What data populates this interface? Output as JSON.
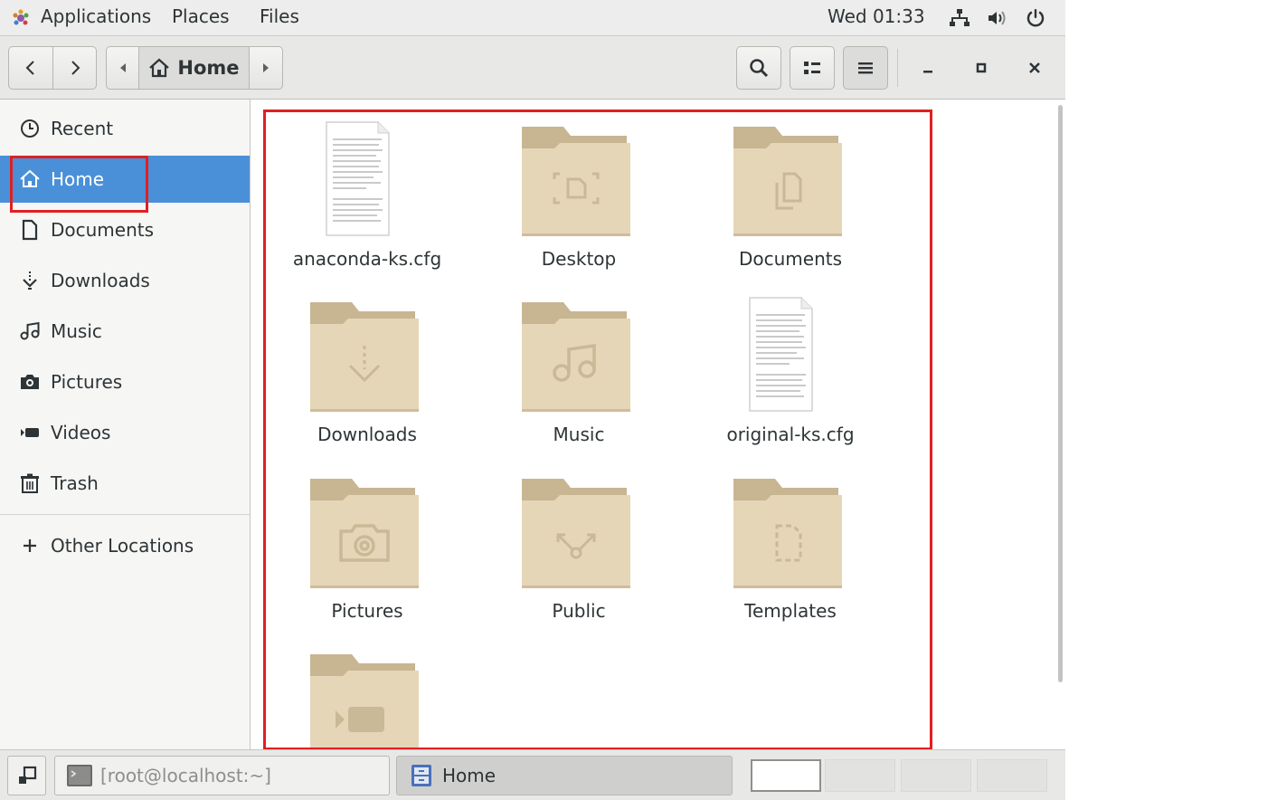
{
  "topbar": {
    "applications_label": "Applications",
    "places_label": "Places",
    "files_label": "Files",
    "clock": "Wed 01:33",
    "tray_icons": [
      "network-icon",
      "volume-icon",
      "power-icon"
    ]
  },
  "headerbar": {
    "path_current": "Home",
    "icons": [
      "back-icon",
      "forward-icon",
      "search-icon",
      "list-view-icon",
      "menu-icon",
      "minimize-icon",
      "maximize-icon",
      "close-icon"
    ]
  },
  "sidebar": {
    "items": [
      {
        "label": "Recent",
        "icon": "clock-icon"
      },
      {
        "label": "Home",
        "icon": "home-icon",
        "active": true
      },
      {
        "label": "Documents",
        "icon": "document-icon"
      },
      {
        "label": "Downloads",
        "icon": "download-icon"
      },
      {
        "label": "Music",
        "icon": "music-icon"
      },
      {
        "label": "Pictures",
        "icon": "camera-icon"
      },
      {
        "label": "Videos",
        "icon": "video-icon"
      },
      {
        "label": "Trash",
        "icon": "trash-icon"
      }
    ],
    "other_locations": {
      "label": "Other Locations",
      "icon": "plus-icon"
    }
  },
  "files": [
    {
      "name": "anaconda-ks.cfg",
      "type": "text-file"
    },
    {
      "name": "Desktop",
      "type": "folder",
      "emblem": "desktop"
    },
    {
      "name": "Documents",
      "type": "folder",
      "emblem": "documents"
    },
    {
      "name": "Downloads",
      "type": "folder",
      "emblem": "download"
    },
    {
      "name": "Music",
      "type": "folder",
      "emblem": "music"
    },
    {
      "name": "original-ks.cfg",
      "type": "text-file"
    },
    {
      "name": "Pictures",
      "type": "folder",
      "emblem": "camera"
    },
    {
      "name": "Public",
      "type": "folder",
      "emblem": "share"
    },
    {
      "name": "Templates",
      "type": "folder",
      "emblem": "template"
    },
    {
      "name": "",
      "type": "folder",
      "emblem": "video"
    }
  ],
  "taskbar": {
    "terminal_label": "[root@localhost:~]",
    "home_label": "Home",
    "workspaces": 4
  },
  "colors": {
    "selection": "#4a90d9",
    "folder_tab": "#c8b591",
    "folder_body": "#e6d6b8",
    "annotation": "#e02020"
  }
}
